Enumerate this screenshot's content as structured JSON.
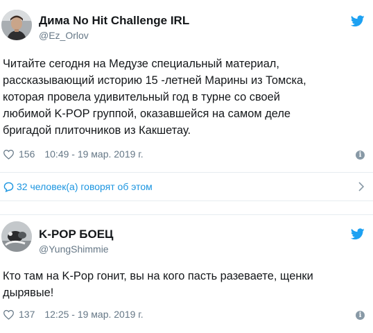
{
  "tweets": [
    {
      "name": "Дима No Hit Challenge IRL",
      "handle": "@Ez_Orlov",
      "text": "Читайте сегодня на Медузе специальный материал,\nрассказывающий историю 15 -летней Марины из Томска,\nкоторая провела удивительный год в турне со своей\nлюбимой K-POP группой, оказавшейся на самом деле\nбригадой плиточников из Какшетау.",
      "likes": "156",
      "timestamp": "10:49 - 19 мар. 2019 г.",
      "icons": {
        "avatar": "avatar",
        "brand": "twitter-bird-icon",
        "like": "heart-icon",
        "info": "info-icon"
      }
    },
    {
      "name": "K-POP БОЕЦ",
      "handle": "@YungShimmie",
      "text": "Кто там на K-Pop гонит, вы на кого пасть разеваете, щенки\nдырявые!",
      "likes": "137",
      "timestamp": "12:25 - 19 мар. 2019 г.",
      "icons": {
        "avatar": "avatar",
        "brand": "twitter-bird-icon",
        "like": "heart-icon",
        "info": "info-icon"
      }
    }
  ],
  "conversation": {
    "label": "32 человек(а) говорят об этом",
    "icons": {
      "chat": "chat-bubble-icon",
      "chevron": "chevron-right-icon"
    }
  },
  "colors": {
    "link_blue": "#1b95e0",
    "twitter_blue": "#1da1f2",
    "meta_gray": "#657786",
    "text": "#14171a",
    "divider": "#e6ecf0"
  }
}
